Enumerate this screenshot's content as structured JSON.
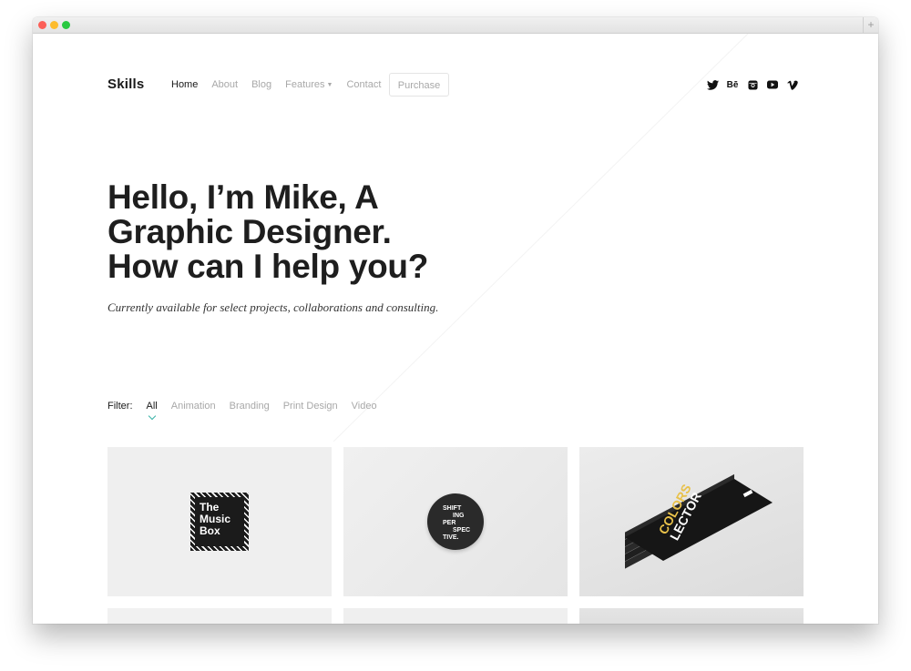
{
  "nav": {
    "logo": "Skills",
    "links": [
      "Home",
      "About",
      "Blog",
      "Features",
      "Contact"
    ],
    "purchase": "Purchase",
    "social_icons": [
      "twitter-icon",
      "behance-icon",
      "instagram-icon",
      "youtube-icon",
      "vimeo-icon"
    ],
    "behance_text": "Bē"
  },
  "hero": {
    "title_lines": [
      "Hello, I’m Mike, A",
      "Graphic Designer.",
      "How can I help you?"
    ],
    "subtitle": "Currently available for select projects, collaborations and consulting."
  },
  "filter": {
    "label": "Filter:",
    "items": [
      "All",
      "Animation",
      "Branding",
      "Print Design",
      "Video"
    ],
    "active_color": "#3ab3a8"
  },
  "portfolio": {
    "tile1_lines": [
      "The",
      "Music",
      "Box"
    ],
    "tile2_lines": [
      "SHIFT",
      "ING",
      "PER",
      "SPEC",
      "TIVE."
    ],
    "tile3_lines": [
      "COLORS",
      "LECTOR"
    ]
  }
}
